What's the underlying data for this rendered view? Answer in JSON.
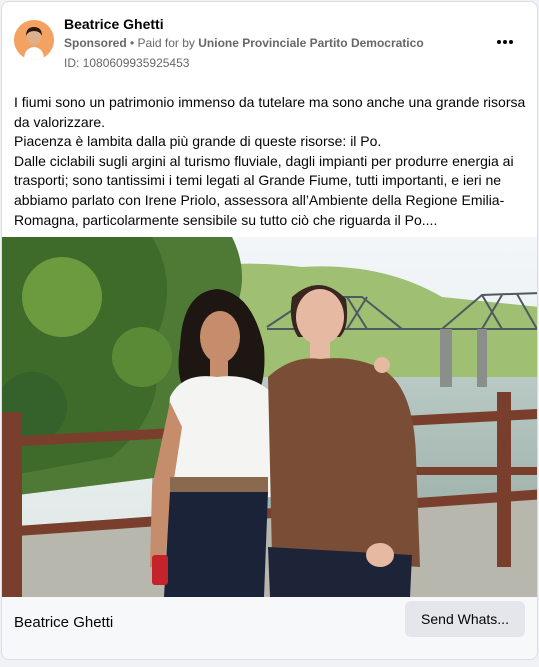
{
  "post": {
    "author": "Beatrice Ghetti",
    "sponsored_label": "Sponsored",
    "paid_for_prefix": " • Paid for by ",
    "advertiser": "Unione Provinciale Partito Democratico",
    "ad_id": "ID: 1080609935925453",
    "more_icon": "more-horizontal-icon",
    "body": [
      "I fiumi sono un patrimonio immenso da tutelare ma sono anche una grande risorsa da valorizzare.",
      "Piacenza è lambita dalla più grande di queste risorse: il Po.",
      "Dalle ciclabili sugli argini al turismo fluviale, dagli impianti per produrre energia ai trasporti; sono tantissimi i temi legati al Grande Fiume, tutti importanti, e ieri ne abbiamo parlato con Irene Priolo, assessora all’Ambiente della Regione Emilia-Romagna, particolarmente sensibile su tutto ciò che riguarda il Po...."
    ]
  },
  "footer": {
    "page_name": "Beatrice Ghetti",
    "cta_label": "Send Whats..."
  },
  "colors": {
    "card_bg": "#ffffff",
    "meta_gray": "#65676b",
    "cta_bg": "#e4e6eb",
    "avatar_bg": "#f4a261"
  }
}
